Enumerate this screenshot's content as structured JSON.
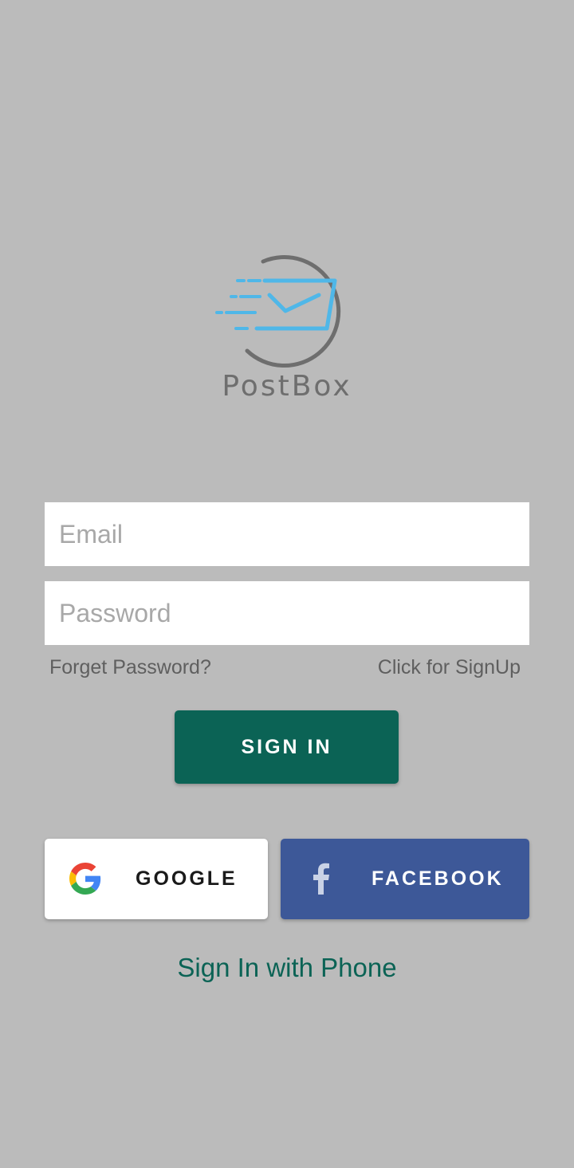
{
  "app": {
    "logo_text": "PostBox"
  },
  "login_form": {
    "email_placeholder": "Email",
    "email_value": "",
    "password_placeholder": "Password",
    "password_value": "",
    "forget_password_label": "Forget Password?",
    "signup_label": "Click for SignUp",
    "sign_in_label": "SIGN IN"
  },
  "social": {
    "google_label": "GOOGLE",
    "google_icon": "google-g-icon",
    "facebook_label": "FACEBOOK",
    "facebook_icon": "facebook-f-icon"
  },
  "phone_signin_label": "Sign In with Phone",
  "colors": {
    "background": "#bbbbbb",
    "primary": "#0b6355",
    "facebook": "#3d5898",
    "logo_accent": "#4fb7e8",
    "logo_gray": "#6e6e6e"
  }
}
